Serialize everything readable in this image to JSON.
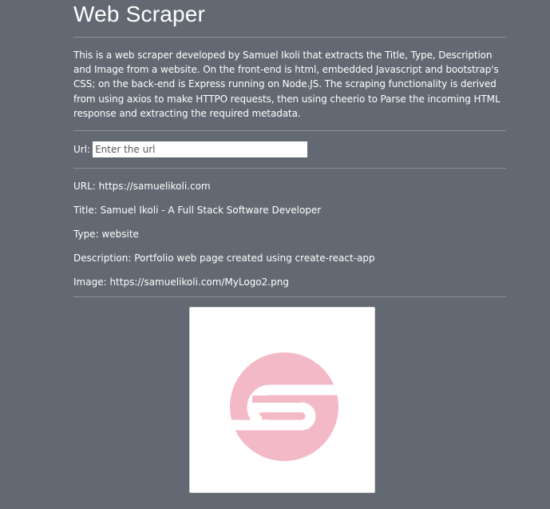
{
  "page": {
    "title": "Web Scraper",
    "intro": "This is a web scraper developed by Samuel Ikoli that extracts the Title, Type, Description and Image from a website. On the front-end is html, embedded Javascript and bootstrap's CSS; on the back-end is Express running on Node.JS. The scraping functionality is derived from using axios to make HTTPO requests, then using cheerio to Parse the incoming HTML response and extracting the required metadata."
  },
  "form": {
    "url_label": "Url:",
    "url_placeholder": "Enter the url",
    "url_value": ""
  },
  "results": {
    "url": "URL: https://samuelikoli.com",
    "title": "Title: Samuel Ikoli - A Full Stack Software Developer",
    "type": "Type: website",
    "description": "Description: Portfolio web page created using create-react-app",
    "image": "Image: https://samuelikoli.com/MyLogo2.png"
  },
  "preview": {
    "logo_icon": "s-logo-icon",
    "logo_color": "#f4b9c6",
    "background_color": "#ffffff"
  },
  "colors": {
    "page_background": "#636972",
    "text": "#ffffff",
    "rule": "#8b9098"
  }
}
